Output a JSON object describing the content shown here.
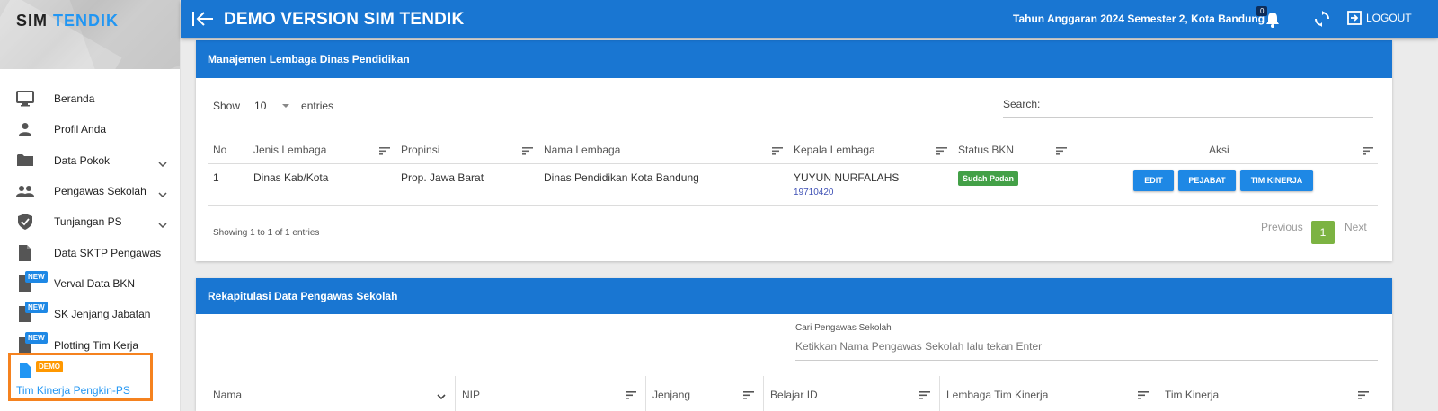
{
  "brand": {
    "part1": "SIM",
    "part2": "TENDIK"
  },
  "header": {
    "title": "DEMO VERSION SIM TENDIK",
    "period": "Tahun Anggaran 2024 Semester 2, Kota Bandung",
    "notif_count": "0",
    "logout_label": "LOGOUT"
  },
  "sidebar": {
    "items": [
      {
        "label": "Beranda",
        "icon": "monitor-icon"
      },
      {
        "label": "Profil Anda",
        "icon": "person-icon"
      },
      {
        "label": "Data Pokok",
        "icon": "folder-icon",
        "expandable": true
      },
      {
        "label": "Pengawas Sekolah",
        "icon": "group-icon",
        "expandable": true
      },
      {
        "label": "Tunjangan PS",
        "icon": "shield-icon",
        "expandable": true
      },
      {
        "label": "Data SKTP Pengawas",
        "icon": "document-icon"
      },
      {
        "label": "Verval Data BKN",
        "icon": "document-icon",
        "badge": "NEW"
      },
      {
        "label": "SK Jenjang Jabatan",
        "icon": "document-icon",
        "badge": "NEW"
      },
      {
        "label": "Plotting Tim Kerja",
        "icon": "document-icon",
        "badge": "NEW"
      }
    ],
    "active": {
      "label": "Tim Kinerja Pengkin-PS",
      "badge": "DEMO"
    }
  },
  "panel1": {
    "title": "Manajemen Lembaga Dinas Pendidikan",
    "show_label": "Show",
    "entries_value": "10",
    "entries_label": "entries",
    "search_label": "Search:",
    "columns": [
      "No",
      "Jenis Lembaga",
      "Propinsi",
      "Nama Lembaga",
      "Kepala Lembaga",
      "Status BKN",
      "Aksi"
    ],
    "row": {
      "no": "1",
      "jenis": "Dinas Kab/Kota",
      "propinsi": "Prop. Jawa Barat",
      "nama": "Dinas Pendidikan Kota Bandung",
      "kepala": "YUYUN NURFALAHS",
      "nip": "19710420",
      "status": "Sudah Padan",
      "actions": [
        "EDIT",
        "PEJABAT",
        "TIM KINERJA"
      ]
    },
    "info": "Showing 1 to 1 of 1 entries",
    "pager": {
      "prev": "Previous",
      "current": "1",
      "next": "Next"
    }
  },
  "panel2": {
    "title": "Rekapitulasi Data Pengawas Sekolah",
    "search_label": "Cari Pengawas Sekolah",
    "search_placeholder": "Ketikkan Nama Pengawas Sekolah lalu tekan Enter",
    "columns": [
      "Nama",
      "NIP",
      "Jenjang",
      "Belajar ID",
      "Lembaga Tim Kinerja",
      "Tim Kinerja"
    ]
  },
  "colors": {
    "primary": "#1976d2",
    "accent": "#2196f3",
    "highlight": "#f5821f",
    "success": "#43a047",
    "pager_active": "#7cb342"
  }
}
